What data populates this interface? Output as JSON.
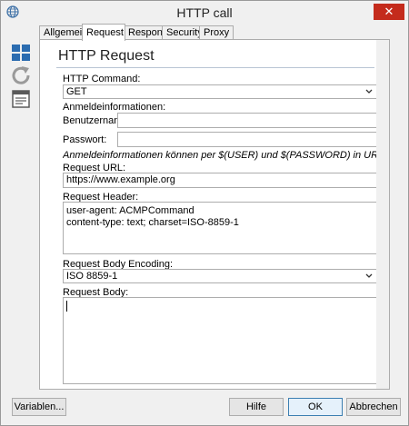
{
  "window": {
    "title": "HTTP call",
    "close_glyph": "✕"
  },
  "sidebar": {
    "icons": [
      "grid-icon",
      "refresh-icon",
      "document-icon"
    ]
  },
  "tabs": [
    {
      "label": "Allgemein",
      "active": false
    },
    {
      "label": "Request",
      "active": true
    },
    {
      "label": "Response",
      "active": false
    },
    {
      "label": "Security",
      "active": false
    },
    {
      "label": "Proxy",
      "active": false
    }
  ],
  "form": {
    "heading": "HTTP Request",
    "http_command_label": "HTTP Command:",
    "http_command_value": "GET",
    "credentials_label": "Anmeldeinformationen:",
    "username_label": "Benutzername:",
    "username_value": "",
    "password_label": "Passwort:",
    "password_value": "",
    "credentials_note": "Anmeldeinformationen können per $(USER) und $(PASSWORD) in URL und Header verwer",
    "url_label": "Request URL:",
    "url_value": "https://www.example.org",
    "header_label": "Request Header:",
    "header_value": "user-agent: ACMPCommand\ncontent-type: text; charset=ISO-8859-1",
    "encoding_label": "Request Body Encoding:",
    "encoding_value": "ISO 8859-1",
    "body_label": "Request Body:",
    "body_value": ""
  },
  "footer": {
    "variables_label": "Variablen...",
    "help_label": "Hilfe",
    "ok_label": "OK",
    "cancel_label": "Abbrechen"
  },
  "colors": {
    "accent": "#2b6cb0",
    "close": "#c42b1c"
  }
}
